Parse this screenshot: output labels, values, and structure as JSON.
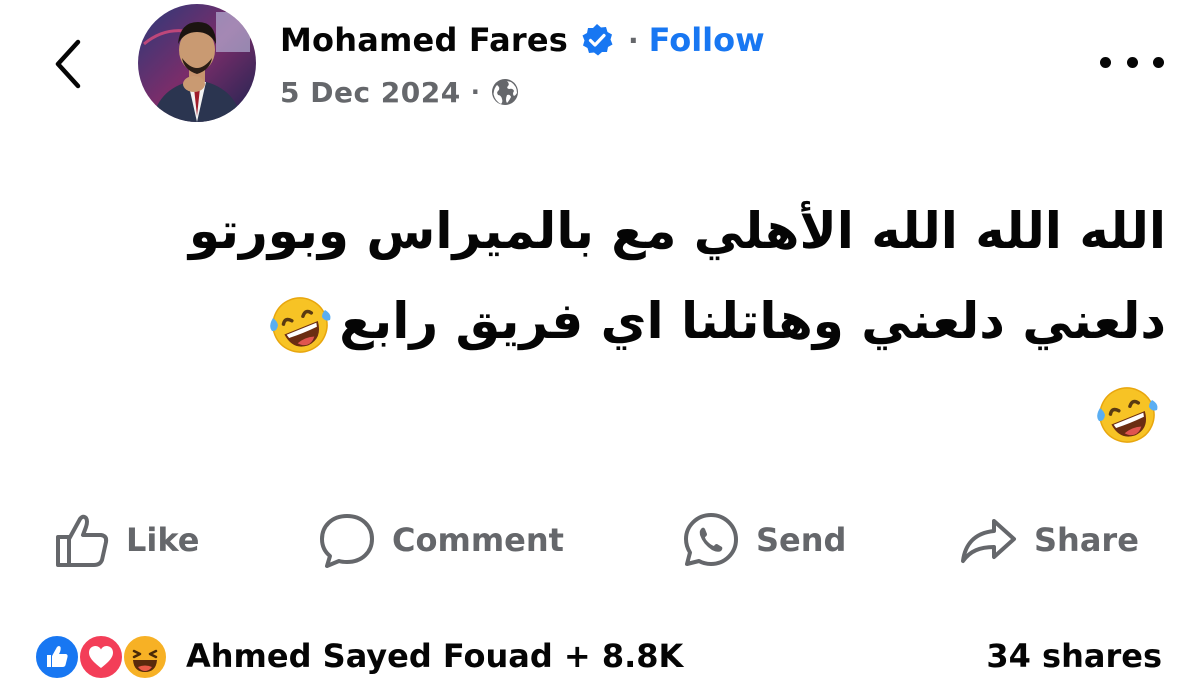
{
  "header": {
    "author_name": "Mohamed Fares",
    "follow_label": "Follow",
    "date": "5 Dec 2024",
    "audience_icon": "globe-icon",
    "verified_icon": "verified-badge-icon",
    "back_icon": "chevron-left-icon",
    "more_icon": "more-horizontal-icon"
  },
  "post": {
    "line1": "الله الله الله الأهلي مع بالميراس وبورتو",
    "line2": "دلعني دلعني وهاتلنا اي فريق رابع",
    "emoji_icon": "rolling-on-floor-laughing-emoji"
  },
  "actions": {
    "like_label": "Like",
    "comment_label": "Comment",
    "send_label": "Send",
    "share_label": "Share"
  },
  "footer": {
    "reactors": "Ahmed Sayed Fouad + 8.8K",
    "shares": "34 shares",
    "reaction_icons": [
      "like-reaction-icon",
      "love-reaction-icon",
      "haha-reaction-icon"
    ]
  },
  "colors": {
    "accent": "#1877f2",
    "secondary_text": "#65676b",
    "primary_text": "#050505",
    "love": "#f33e58",
    "haha": "#f7b125"
  }
}
